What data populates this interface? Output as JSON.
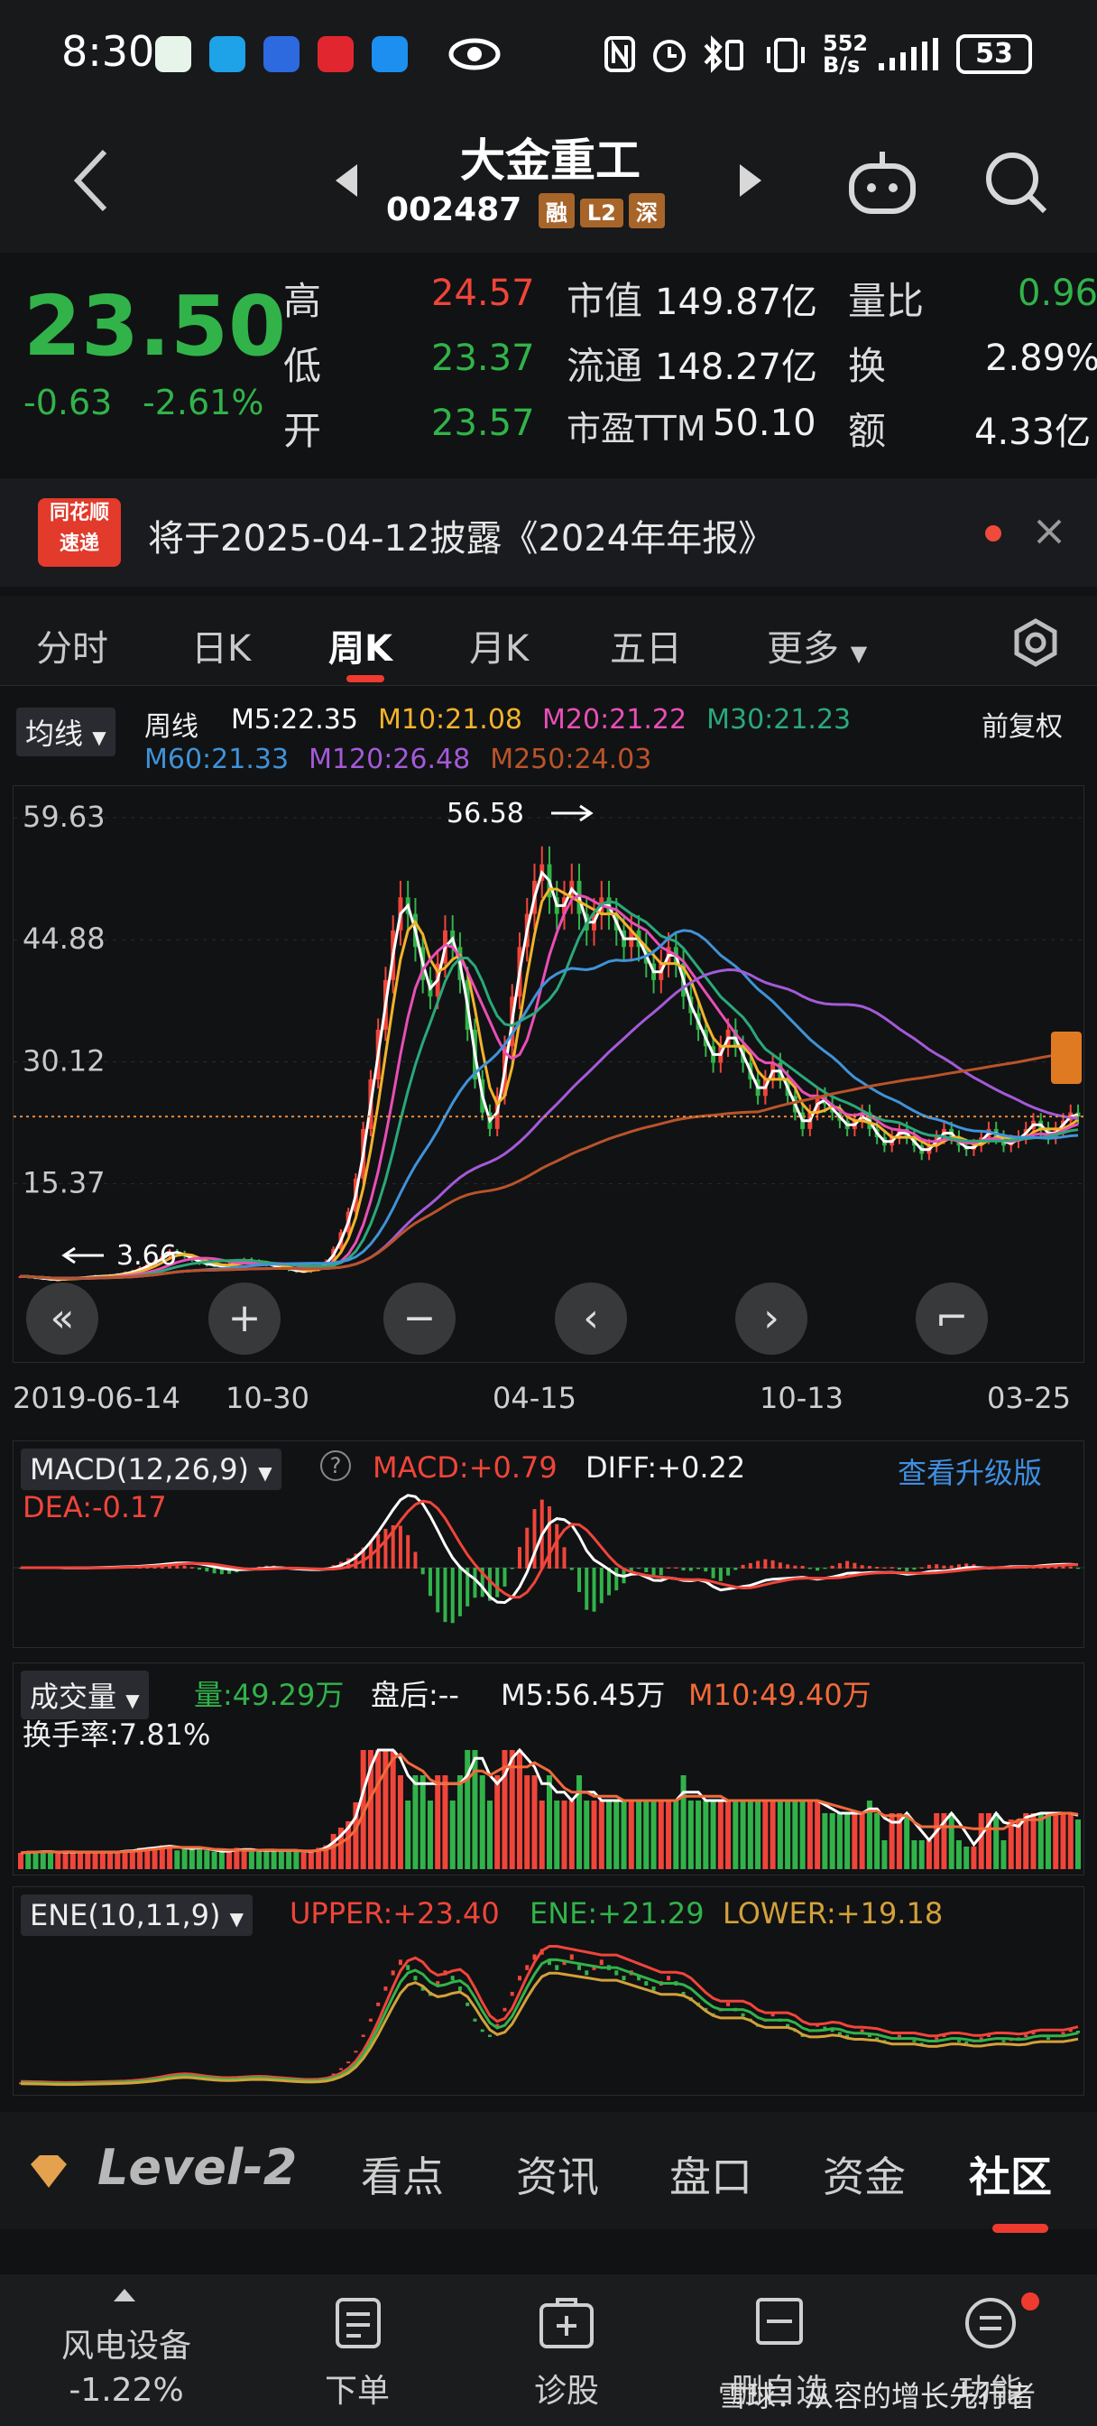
{
  "status": {
    "time": "8:30",
    "net_speed_top": "552",
    "net_speed_bottom": "B/s",
    "battery": "53"
  },
  "header": {
    "title": "大金重工",
    "code": "002487",
    "tags": [
      "融",
      "L2",
      "深"
    ]
  },
  "quote": {
    "price": "23.50",
    "change": "-0.63",
    "change_pct": "-2.61%",
    "labels": {
      "high": "高",
      "low": "低",
      "open": "开",
      "mcap": "市值",
      "float": "流通",
      "pe": "市盈TTM",
      "vol_ratio": "量比",
      "turnover": "换",
      "amount": "额"
    },
    "high": "24.57",
    "low": "23.37",
    "open": "23.57",
    "mcap": "149.87亿",
    "float": "148.27亿",
    "pe": "50.10",
    "vol_ratio": "0.96",
    "turnover": "2.89%",
    "amount": "4.33亿"
  },
  "notice": {
    "logo_top": "同花顺",
    "logo_bottom": "速递",
    "text": "将于2025-04-12披露《2024年年报》"
  },
  "tabs": [
    "分时",
    "日K",
    "周K",
    "月K",
    "五日",
    "更多"
  ],
  "active_tab": "周K",
  "ma": {
    "type_label": "均线",
    "period_label": "周线",
    "adjust_label": "前复权",
    "items": [
      {
        "label": "M5:22.35",
        "color": "#ffffff"
      },
      {
        "label": "M10:21.08",
        "color": "#f2b32a"
      },
      {
        "label": "M20:21.22",
        "color": "#e84fb6"
      },
      {
        "label": "M30:21.23",
        "color": "#2aa87a"
      },
      {
        "label": "M60:21.33",
        "color": "#3f93d8"
      },
      {
        "label": "M120:26.48",
        "color": "#a45ad8"
      },
      {
        "label": "M250:24.03",
        "color": "#b9542a"
      }
    ]
  },
  "chart_data": {
    "type": "candlestick",
    "y_ticks": [
      "59.63",
      "44.88",
      "30.12",
      "15.37"
    ],
    "x_ticks": [
      "2019-06-14",
      "10-30",
      "04-15",
      "10-13",
      "03-25"
    ],
    "annotations": {
      "max": "56.58",
      "min": "3.66"
    },
    "ylim": [
      3.66,
      59.63
    ],
    "close_series": [
      4.2,
      4.1,
      4.0,
      3.9,
      3.8,
      3.8,
      3.9,
      4.0,
      4.0,
      4.1,
      4.2,
      4.2,
      4.3,
      4.4,
      4.6,
      4.8,
      5.2,
      5.6,
      6.0,
      6.6,
      7.2,
      7.0,
      6.6,
      6.2,
      5.8,
      5.6,
      5.5,
      5.4,
      5.6,
      6.0,
      6.2,
      6.0,
      5.8,
      5.6,
      5.4,
      5.2,
      5.0,
      4.8,
      4.8,
      5.0,
      5.4,
      6.0,
      7.5,
      9.5,
      12.0,
      16.0,
      22.0,
      28.0,
      34.0,
      40.0,
      46.0,
      50.0,
      48.0,
      44.0,
      40.0,
      38.0,
      42.0,
      46.0,
      44.0,
      40.0,
      34.0,
      28.0,
      24.0,
      22.0,
      26.0,
      32.0,
      38.0,
      44.0,
      48.0,
      52.0,
      54.0,
      50.0,
      48.0,
      50.0,
      52.0,
      48.0,
      46.0,
      48.0,
      50.0,
      48.0,
      46.0,
      44.0,
      46.0,
      44.0,
      42.0,
      40.0,
      42.0,
      44.0,
      42.0,
      38.0,
      36.0,
      34.0,
      32.0,
      30.0,
      32.0,
      34.0,
      32.0,
      30.0,
      28.0,
      26.0,
      28.0,
      30.0,
      28.0,
      26.0,
      24.0,
      22.0,
      24.0,
      26.0,
      25.0,
      24.0,
      23.0,
      22.0,
      23.0,
      24.0,
      22.0,
      21.0,
      20.0,
      21.0,
      22.0,
      21.0,
      20.0,
      19.0,
      20.0,
      21.0,
      22.0,
      21.0,
      20.0,
      19.5,
      20.0,
      21.0,
      22.0,
      21.0,
      20.0,
      20.5,
      21.0,
      22.0,
      23.0,
      22.0,
      21.0,
      22.0,
      23.0,
      24.0,
      23.5
    ]
  },
  "chart_controls": [
    "«",
    "+",
    "−",
    "‹",
    "›",
    "⌐"
  ],
  "macd": {
    "title": "MACD(12,26,9)",
    "macd": "MACD:+0.79",
    "diff": "DIFF:+0.22",
    "dea": "DEA:-0.17",
    "upgrade": "查看升级版"
  },
  "volume": {
    "title": "成交量",
    "vol": "量:49.29万",
    "after": "盘后:--",
    "m5": "M5:56.45万",
    "m10": "M10:49.40万",
    "turnover": "换手率:7.81%"
  },
  "ene": {
    "title": "ENE(10,11,9)",
    "upper": "UPPER:+23.40",
    "ene": "ENE:+21.29",
    "lower": "LOWER:+19.18"
  },
  "bottom_tabs": [
    "Level-2",
    "看点",
    "资讯",
    "盘口",
    "资金",
    "社区"
  ],
  "footer": {
    "sector": "风电设备",
    "sector_change": "-1.22%",
    "items": [
      "下单",
      "诊股",
      "删自选",
      "功能"
    ],
    "watermark": "雪球：从容的增长先行者"
  }
}
